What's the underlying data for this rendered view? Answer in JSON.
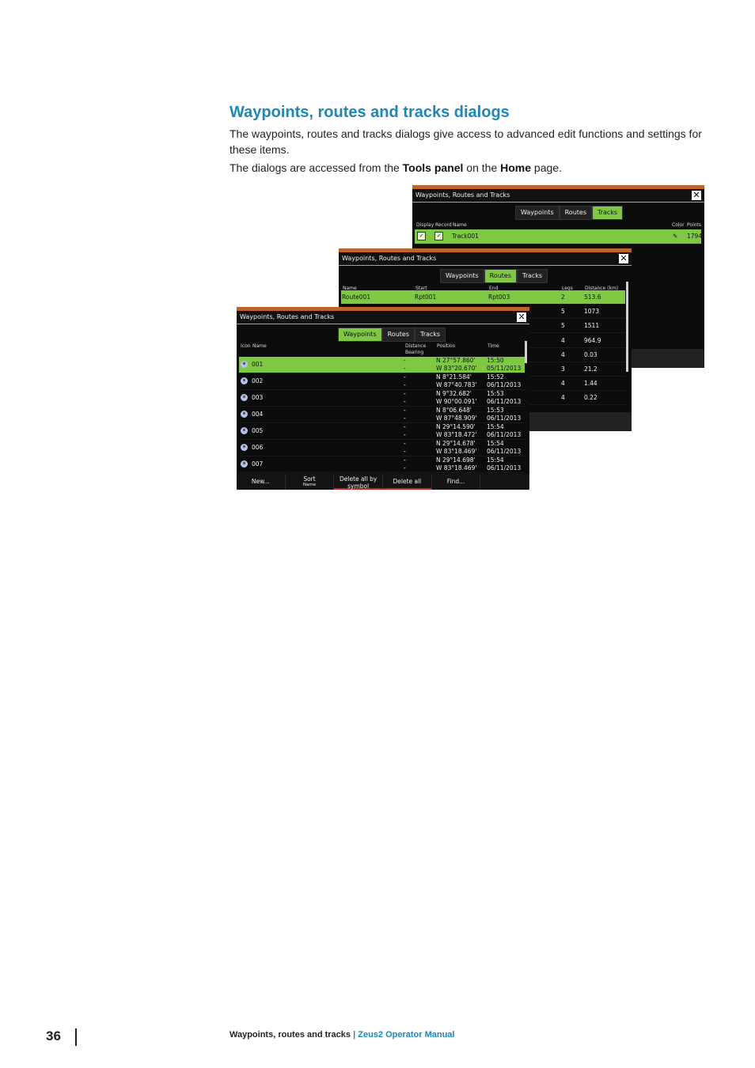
{
  "heading": "Waypoints, routes and tracks dialogs",
  "paragraph1": "The waypoints, routes and tracks dialogs give access to advanced edit functions and settings for these items.",
  "paragraph2": {
    "before": "The dialogs are accessed from the ",
    "bold1": "Tools panel",
    "middle": " on the ",
    "bold2": "Home",
    "after": " page."
  },
  "dialog_title": "Waypoints, Routes and Tracks",
  "close_glyph": "✕",
  "tabs": [
    "Waypoints",
    "Routes",
    "Tracks"
  ],
  "tracks": {
    "columns": [
      "Display",
      "Record",
      "Name",
      "Color",
      "Points"
    ],
    "rows": [
      {
        "name": "Track001",
        "points": "1794"
      }
    ]
  },
  "routes": {
    "columns": [
      "Name",
      "Start",
      "End",
      "Legs",
      "Distance (km)"
    ],
    "rows": [
      {
        "name": "Route001",
        "start": "Rpt001",
        "end": "Rpt003",
        "legs": "2",
        "distance": "513.6"
      },
      {
        "name": "",
        "start": "",
        "end": "",
        "legs": "5",
        "distance": "1073"
      },
      {
        "name": "",
        "start": "",
        "end": "",
        "legs": "5",
        "distance": "1511"
      },
      {
        "name": "",
        "start": "",
        "end": "",
        "legs": "4",
        "distance": "964.9"
      },
      {
        "name": "",
        "start": "",
        "end": "",
        "legs": "4",
        "distance": "0.03"
      },
      {
        "name": "",
        "start": "",
        "end": "",
        "legs": "3",
        "distance": "21.2"
      },
      {
        "name": "",
        "start": "",
        "end": "",
        "legs": "4",
        "distance": "1.44"
      },
      {
        "name": "",
        "start": "",
        "end": "",
        "legs": "4",
        "distance": "0.22"
      }
    ]
  },
  "waypoints": {
    "columns": [
      "Icon",
      "Name",
      "Distance",
      "Bearing",
      "Position",
      "Time"
    ],
    "rows": [
      {
        "name": "001",
        "dist": "-",
        "bear": "-",
        "lat": "N  27°57.860'",
        "lon": "W  83°20.670'",
        "time": "15:50",
        "date": "05/11/2013"
      },
      {
        "name": "002",
        "dist": "-",
        "bear": "-",
        "lat": "N  8°21.584'",
        "lon": "W  87°40.783'",
        "time": "15:52",
        "date": "06/11/2013"
      },
      {
        "name": "003",
        "dist": "-",
        "bear": "-",
        "lat": "N  9°32.682'",
        "lon": "W  90°00.091'",
        "time": "15:53",
        "date": "06/11/2013"
      },
      {
        "name": "004",
        "dist": "-",
        "bear": "-",
        "lat": "N  8°06.648'",
        "lon": "W  87°48.909'",
        "time": "15:53",
        "date": "06/11/2013"
      },
      {
        "name": "005",
        "dist": "-",
        "bear": "-",
        "lat": "N  29°14.590'",
        "lon": "W  83°18.472'",
        "time": "15:54",
        "date": "06/11/2013"
      },
      {
        "name": "006",
        "dist": "-",
        "bear": "-",
        "lat": "N  29°14.678'",
        "lon": "W  83°18.469'",
        "time": "15:54",
        "date": "06/11/2013"
      },
      {
        "name": "007",
        "dist": "-",
        "bear": "-",
        "lat": "N  29°14.698'",
        "lon": "W  83°18.469'",
        "time": "15:54",
        "date": "06/11/2013"
      }
    ],
    "buttons": {
      "new": "New...",
      "sort": "Sort",
      "sort_sub": "Name",
      "delete_by_symbol_1": "Delete all by",
      "delete_by_symbol_2": "symbol",
      "delete_all": "Delete all",
      "find": "Find..."
    }
  },
  "colors": {
    "accent": "#7fc843",
    "heading": "#1f86b5",
    "titlebar_stripe": "#c0632a"
  },
  "footer": {
    "page": "36",
    "section": "Waypoints, routes and tracks",
    "separator": " | ",
    "manual": "Zeus2 Operator Manual"
  }
}
